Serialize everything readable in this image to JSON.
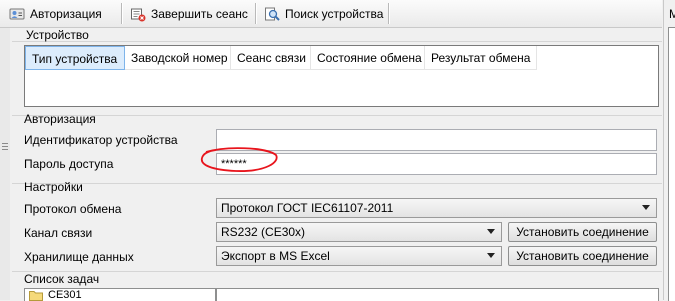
{
  "toolbar": {
    "auth_label": "Авторизация",
    "end_session_label": "Завершить сеанс",
    "search_label": "Поиск устройства"
  },
  "right_panel": {
    "title_letter": "М"
  },
  "device_group": {
    "title": "Устройство",
    "columns": [
      "Тип устройства",
      "Заводской номер",
      "Сеанс связи",
      "Состояние обмена",
      "Результат обмена"
    ]
  },
  "auth_group": {
    "title": "Авторизация",
    "device_id_label": "Идентификатор устройства",
    "device_id_value": "",
    "password_label": "Пароль доступа",
    "password_value": "******"
  },
  "settings_group": {
    "title": "Настройки",
    "protocol_label": "Протокол обмена",
    "protocol_value": "Протокол ГОСТ IEC61107-2011",
    "channel_label": "Канал связи",
    "channel_value": "RS232 (CE30x)",
    "channel_button": "Установить соединение",
    "storage_label": "Хранилище данных",
    "storage_value": "Экспорт в MS Excel",
    "storage_button": "Установить соединение"
  },
  "tasks_group": {
    "title": "Список задач",
    "items": [
      "CE301"
    ]
  },
  "colors": {
    "selection": "#dcecfc",
    "annotation": "#e8141c"
  }
}
